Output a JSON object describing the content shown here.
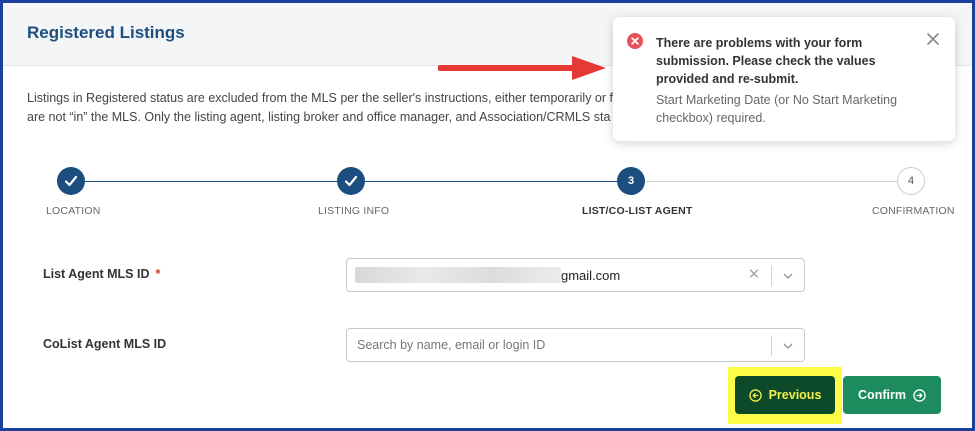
{
  "header": {
    "title": "Registered Listings"
  },
  "description": {
    "line1": "Listings in Registered status are excluded from the MLS per the seller's instructions, either temporarily or f",
    "line2": "are not “in” the MLS. Only the listing agent, listing broker and office manager, and Association/CRMLS sta"
  },
  "stepper": {
    "steps": [
      {
        "label": "LOCATION",
        "state": "done"
      },
      {
        "label": "LISTING INFO",
        "state": "done"
      },
      {
        "label": "LIST/CO-LIST AGENT",
        "state": "active",
        "number": "3"
      },
      {
        "label": "CONFIRMATION",
        "state": "todo",
        "number": "4"
      }
    ]
  },
  "form": {
    "list_agent": {
      "label": "List Agent MLS ID",
      "required_mark": "*",
      "value": "gmail.com"
    },
    "colist_agent": {
      "label": "CoList Agent MLS ID",
      "placeholder": "Search by name, email or login ID"
    }
  },
  "buttons": {
    "previous": "Previous",
    "confirm": "Confirm"
  },
  "toast": {
    "title": "There are problems with your form submission. Please check the values provided and re-submit.",
    "body": "Start Marketing Date (or No Start Marketing checkbox) required."
  },
  "colors": {
    "brand": "#1c4e80",
    "border": "#1a3f9c",
    "previous_bg": "#0d4a2a",
    "confirm_bg": "#1c8b5e",
    "highlight": "#fdfd48",
    "error": "#e8505b",
    "arrow": "#e53935"
  }
}
